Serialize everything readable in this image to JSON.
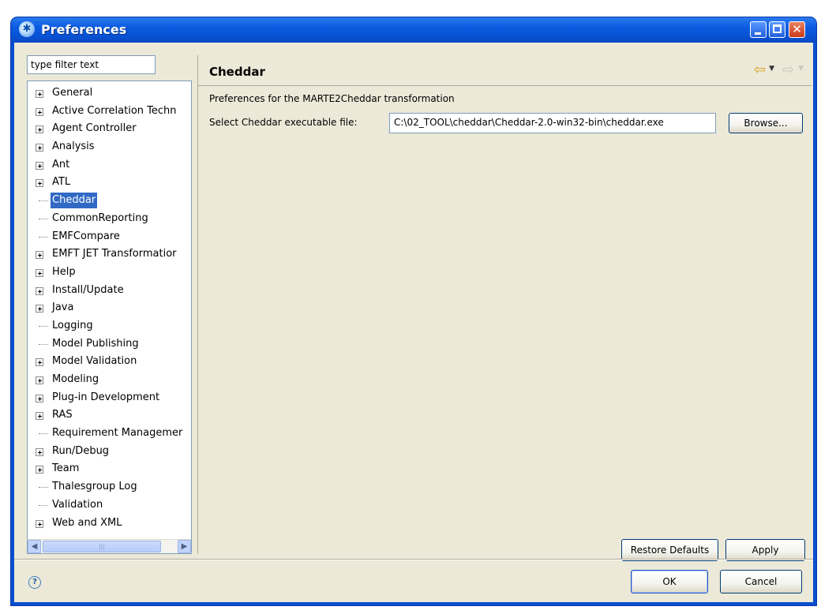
{
  "window": {
    "title": "Preferences"
  },
  "filter": {
    "placeholder": "type filter text"
  },
  "tree": {
    "items": [
      {
        "label": "General",
        "expandable": true
      },
      {
        "label": "Active Correlation Techn",
        "expandable": true
      },
      {
        "label": "Agent Controller",
        "expandable": true
      },
      {
        "label": "Analysis",
        "expandable": true
      },
      {
        "label": "Ant",
        "expandable": true
      },
      {
        "label": "ATL",
        "expandable": true
      },
      {
        "label": "Cheddar",
        "expandable": false,
        "selected": true
      },
      {
        "label": "CommonReporting",
        "expandable": false
      },
      {
        "label": "EMFCompare",
        "expandable": false
      },
      {
        "label": "EMFT JET Transformatior",
        "expandable": true
      },
      {
        "label": "Help",
        "expandable": true
      },
      {
        "label": "Install/Update",
        "expandable": true
      },
      {
        "label": "Java",
        "expandable": true
      },
      {
        "label": "Logging",
        "expandable": false
      },
      {
        "label": "Model Publishing",
        "expandable": false
      },
      {
        "label": "Model Validation",
        "expandable": true
      },
      {
        "label": "Modeling",
        "expandable": true
      },
      {
        "label": "Plug-in Development",
        "expandable": true
      },
      {
        "label": "RAS",
        "expandable": true
      },
      {
        "label": "Requirement Managemer",
        "expandable": false
      },
      {
        "label": "Run/Debug",
        "expandable": true
      },
      {
        "label": "Team",
        "expandable": true
      },
      {
        "label": "Thalesgroup Log",
        "expandable": false
      },
      {
        "label": "Validation",
        "expandable": false
      },
      {
        "label": "Web and XML",
        "expandable": true
      }
    ]
  },
  "page": {
    "title": "Cheddar",
    "description": "Preferences for the MARTE2Cheddar transformation",
    "field_label": "Select Cheddar executable file:",
    "field_value": "C:\\02_TOOL\\cheddar\\Cheddar-2.0-win32-bin\\cheddar.exe",
    "browse_label": "Browse...",
    "restore_label": "Restore Defaults",
    "apply_label": "Apply"
  },
  "footer": {
    "ok_label": "OK",
    "cancel_label": "Cancel"
  },
  "colors": {
    "titlebar": "#0753d6",
    "selection": "#316ac5",
    "dialog_bg": "#ece9d8"
  }
}
